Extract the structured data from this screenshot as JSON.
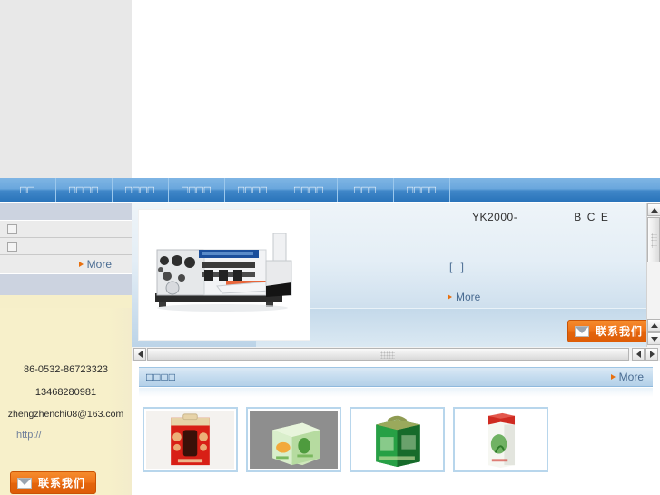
{
  "nav": {
    "items": [
      {
        "label": "□□",
        "name": "nav-home"
      },
      {
        "label": "□□□□",
        "name": "nav-about"
      },
      {
        "label": "□□□□",
        "name": "nav-products"
      },
      {
        "label": "□□□□",
        "name": "nav-news"
      },
      {
        "label": "□□□□",
        "name": "nav-equipment"
      },
      {
        "label": "□□□□",
        "name": "nav-service"
      },
      {
        "label": "□□□",
        "name": "nav-jobs"
      },
      {
        "label": "□□□□",
        "name": "nav-contact"
      }
    ]
  },
  "sidebar": {
    "list_items": [
      {
        "label": "",
        "icon": "square-bullet-icon"
      },
      {
        "label": "",
        "icon": "square-bullet-icon"
      }
    ],
    "more_label": "More",
    "contact": {
      "phone": "86-0532-86723323",
      "mobile": "13468280981",
      "email": "zhengzhenchi08@163.com",
      "url": "http://"
    },
    "contact_button_label": "联系我们",
    "contact_button_icon": "envelope-icon"
  },
  "showcase": {
    "title_prefix": "YK2000-",
    "title_suffix_b": "B",
    "title_suffix_c": "C",
    "title_suffix_e": "E",
    "bracket_text": "[  ]",
    "more_label": "More",
    "contact_button_label": "联系我们",
    "contact_button_icon": "envelope-icon",
    "image_alt": "corrugated-carton-printing-slotting-machine"
  },
  "scrollbars": {
    "vertical_up_icon": "triangle-up-icon",
    "vertical_down_icon": "triangle-down-icon",
    "horizontal_left_icon": "triangle-left-icon",
    "horizontal_right_icon": "triangle-right-icon"
  },
  "products": {
    "header_title": "□□□□",
    "more_label": "More",
    "cards": [
      {
        "name": "product-card-red-gift-box",
        "alt": "red-festive-gift-carton"
      },
      {
        "name": "product-card-green-box",
        "alt": "light-green-printed-carton"
      },
      {
        "name": "product-card-green-handle",
        "alt": "green-handle-carry-carton"
      },
      {
        "name": "product-card-tall-white-box",
        "alt": "tall-white-red-top-carton"
      }
    ]
  },
  "colors": {
    "nav_blue": "#3f86c8",
    "accent_orange": "#e8700f",
    "sidebar_cream": "#f6efc9",
    "link_blue": "#4a6c92",
    "panel_head": "#ccd3e0"
  }
}
